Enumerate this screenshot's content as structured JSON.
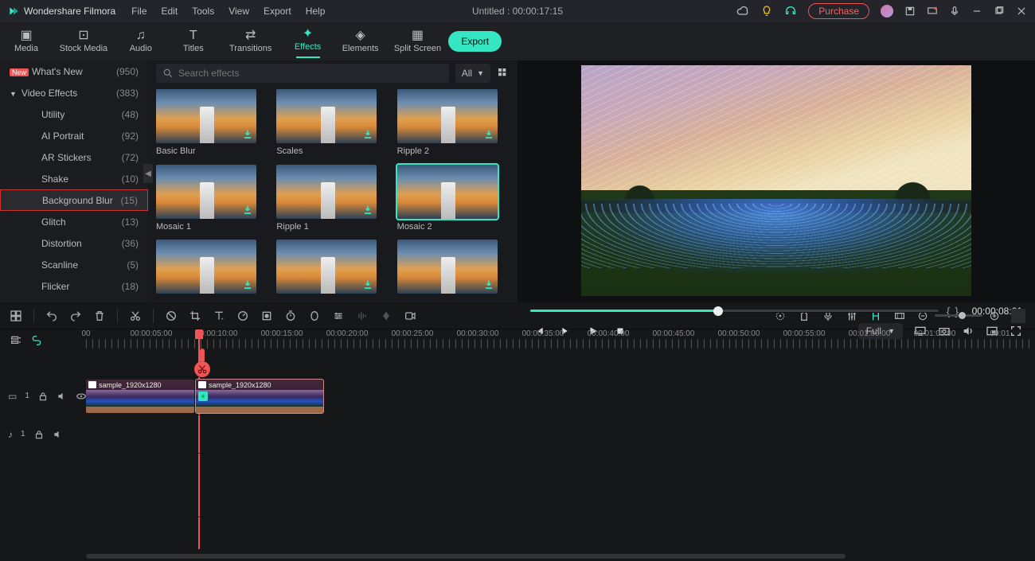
{
  "app": {
    "name": "Wondershare Filmora"
  },
  "menu": [
    "File",
    "Edit",
    "Tools",
    "View",
    "Export",
    "Help"
  ],
  "title": "Untitled : 00:00:17:15",
  "purchase": "Purchase",
  "tooltabs": {
    "items": [
      {
        "label": "Media"
      },
      {
        "label": "Stock Media"
      },
      {
        "label": "Audio"
      },
      {
        "label": "Titles"
      },
      {
        "label": "Transitions"
      },
      {
        "label": "Effects"
      },
      {
        "label": "Elements"
      },
      {
        "label": "Split Screen"
      }
    ],
    "active": "Effects",
    "export": "Export"
  },
  "sidebar": {
    "items": [
      {
        "label": "What's New",
        "count": "(950)",
        "new": true
      },
      {
        "label": "Video Effects",
        "count": "(383)",
        "head": true
      },
      {
        "label": "Utility",
        "count": "(48)",
        "sub": true
      },
      {
        "label": "AI Portrait",
        "count": "(92)",
        "sub": true
      },
      {
        "label": "AR Stickers",
        "count": "(72)",
        "sub": true
      },
      {
        "label": "Shake",
        "count": "(10)",
        "sub": true
      },
      {
        "label": "Background Blur",
        "count": "(15)",
        "sub": true,
        "selected": true
      },
      {
        "label": "Glitch",
        "count": "(13)",
        "sub": true
      },
      {
        "label": "Distortion",
        "count": "(36)",
        "sub": true
      },
      {
        "label": "Scanline",
        "count": "(5)",
        "sub": true
      },
      {
        "label": "Flicker",
        "count": "(18)",
        "sub": true
      }
    ]
  },
  "search": {
    "placeholder": "Search effects"
  },
  "filter": {
    "label": "All"
  },
  "effects": [
    {
      "label": "Basic Blur"
    },
    {
      "label": "Scales"
    },
    {
      "label": "Ripple 2"
    },
    {
      "label": "Mosaic 1"
    },
    {
      "label": "Ripple 1"
    },
    {
      "label": "Mosaic 2",
      "selected": true
    },
    {
      "label": ""
    },
    {
      "label": ""
    },
    {
      "label": ""
    }
  ],
  "preview": {
    "time": "00:00:08:01",
    "quality": "Full"
  },
  "ruler": {
    "labels": [
      "00",
      "00:00:05:00",
      "00:00:10:00",
      "00:00:15:00",
      "00:00:20:00",
      "00:00:25:00",
      "00:00:30:00",
      "00:00:35:00",
      "00:00:40:00",
      "00:00:45:00",
      "00:00:50:00",
      "00:00:55:00",
      "00:01:00:00",
      "00:01:05:00",
      "00:01"
    ]
  },
  "clip": {
    "name": "sample_1920x1280"
  },
  "tracks": {
    "video": "1",
    "audio": "1"
  }
}
